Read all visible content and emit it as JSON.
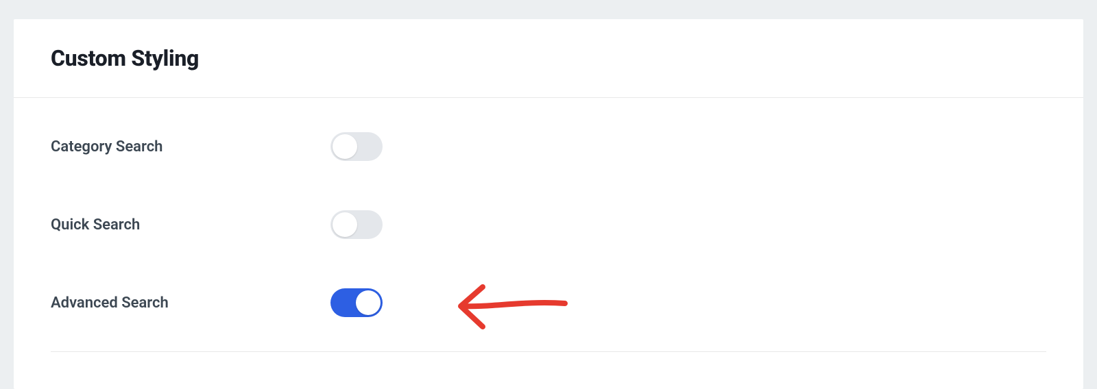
{
  "panel": {
    "title": "Custom Styling"
  },
  "settings": {
    "category_search": {
      "label": "Category Search",
      "enabled": false
    },
    "quick_search": {
      "label": "Quick Search",
      "enabled": false
    },
    "advanced_search": {
      "label": "Advanced Search",
      "enabled": true
    }
  },
  "colors": {
    "toggle_on": "#2d5fe3",
    "toggle_off": "#e4e7eb",
    "annotation": "#e63a2e"
  }
}
